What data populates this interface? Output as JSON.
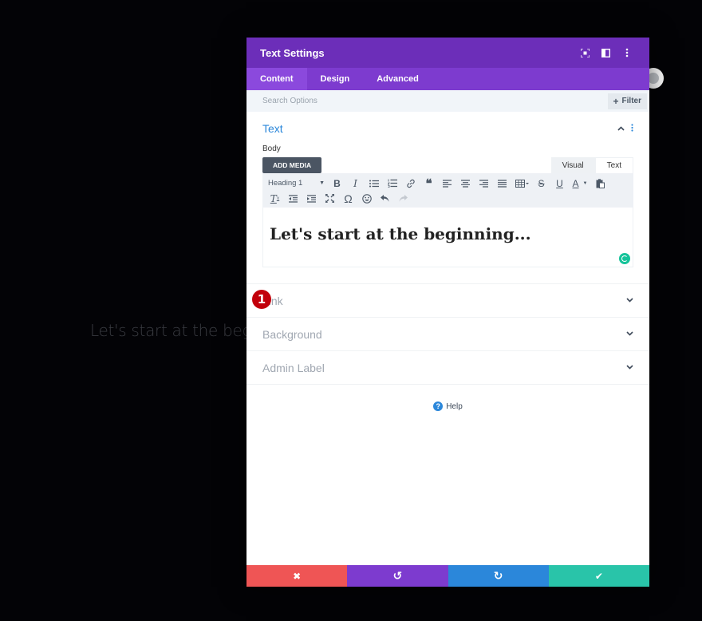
{
  "background": {
    "preview_text": "Let's start at the beginning..."
  },
  "modal": {
    "title": "Text Settings",
    "header_icons": [
      "fullscreen-icon",
      "split-view-icon",
      "more-options-icon"
    ],
    "tabs": [
      {
        "label": "Content",
        "active": true
      },
      {
        "label": "Design",
        "active": false
      },
      {
        "label": "Advanced",
        "active": false
      }
    ],
    "search": {
      "placeholder": "Search Options",
      "value": ""
    },
    "filter_label": "Filter",
    "sections": {
      "text": {
        "title": "Text",
        "body_label": "Body",
        "add_media_label": "ADD MEDIA",
        "editor_tabs": [
          "Visual",
          "Text"
        ],
        "format_select": "Heading 1",
        "content": "Let's start at the beginning...",
        "step_marker": "1"
      },
      "closed": [
        {
          "label": "Link"
        },
        {
          "label": "Background"
        },
        {
          "label": "Admin Label"
        }
      ]
    },
    "help_label": "Help",
    "footer": {
      "buttons": [
        {
          "name": "discard",
          "icon": "✖",
          "color": "#ef5555"
        },
        {
          "name": "undo",
          "icon": "↺",
          "color": "#7d3bcf"
        },
        {
          "name": "redo",
          "icon": "↻",
          "color": "#2b87da"
        },
        {
          "name": "save",
          "icon": "✔",
          "color": "#29c4a9"
        }
      ]
    }
  },
  "colors": {
    "header": "#6c2eb9",
    "tabs": "#7d3bcf",
    "accent_blue": "#2b87da"
  }
}
